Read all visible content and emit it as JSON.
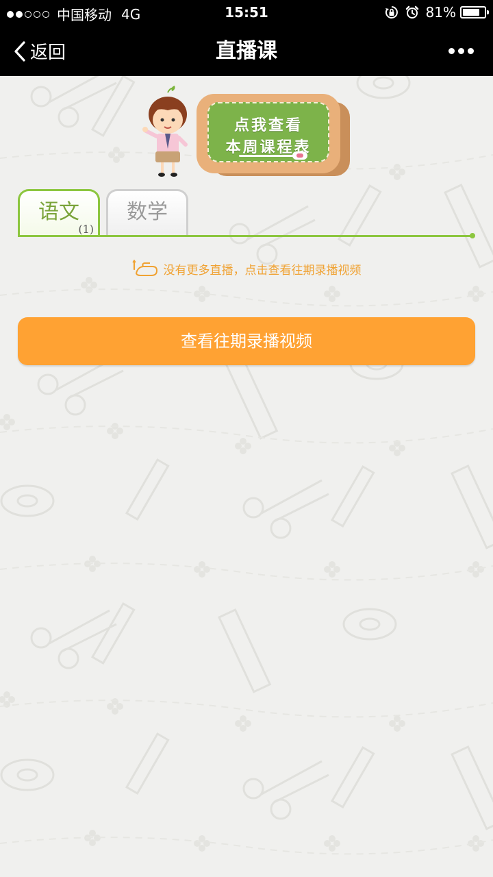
{
  "status_bar": {
    "carrier": "中国移动",
    "network": "4G",
    "time": "15:51",
    "battery_percent": "81%",
    "battery_level": 0.81,
    "signal_strength": 2,
    "signal_max": 5,
    "icons": [
      "orientation-lock-icon",
      "alarm-icon"
    ]
  },
  "nav": {
    "back_label": "返回",
    "title": "直播课",
    "more_icon": "more-dots-icon"
  },
  "banner": {
    "line1": "点我查看",
    "line2": "本周课程表"
  },
  "tabs": [
    {
      "label": "语文",
      "count": "(1)",
      "active": true
    },
    {
      "label": "数学",
      "active": false
    }
  ],
  "hint": {
    "icon": "pointing-hand-icon",
    "text": "没有更多直播，点击查看往期录播视频"
  },
  "button": {
    "label": "查看往期录播视频"
  },
  "colors": {
    "accent_orange": "#ffa233",
    "hint_orange": "#f0a232",
    "tab_green": "#8cc63f",
    "tab_text_green": "#7aa33a",
    "background": "#f0f0ee",
    "bar_black": "#000000"
  }
}
